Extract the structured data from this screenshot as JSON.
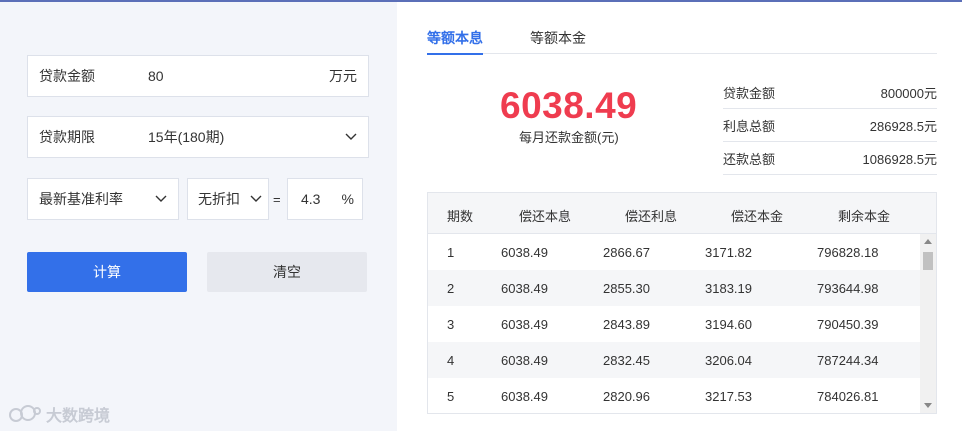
{
  "form": {
    "amount_label": "贷款金额",
    "amount_value": "80",
    "amount_unit": "万元",
    "term_label": "贷款期限",
    "term_value": "15年(180期)",
    "rate_type_label": "最新基准利率",
    "discount_label": "无折扣",
    "equals": "=",
    "rate_value": "4.3",
    "rate_unit": "%",
    "calc_label": "计算",
    "clear_label": "清空"
  },
  "watermark": {
    "text": "大数跨境"
  },
  "tabs": [
    {
      "label": "等额本息",
      "active": true
    },
    {
      "label": "等额本金",
      "active": false
    }
  ],
  "result": {
    "monthly_payment": "6038.49",
    "monthly_caption": "每月还款金额(元)",
    "summary": [
      {
        "label": "贷款金额",
        "value": "800000元"
      },
      {
        "label": "利息总额",
        "value": "286928.5元"
      },
      {
        "label": "还款总额",
        "value": "1086928.5元"
      }
    ]
  },
  "table": {
    "headers": [
      "期数",
      "偿还本息",
      "偿还利息",
      "偿还本金",
      "剩余本金"
    ],
    "rows": [
      [
        "1",
        "6038.49",
        "2866.67",
        "3171.82",
        "796828.18"
      ],
      [
        "2",
        "6038.49",
        "2855.30",
        "3183.19",
        "793644.98"
      ],
      [
        "3",
        "6038.49",
        "2843.89",
        "3194.60",
        "790450.39"
      ],
      [
        "4",
        "6038.49",
        "2832.45",
        "3206.04",
        "787244.34"
      ],
      [
        "5",
        "6038.49",
        "2820.96",
        "3217.53",
        "784026.81"
      ]
    ]
  },
  "colors": {
    "accent": "#3370e9",
    "highlight": "#ef3c4f",
    "panel_bg": "#f3f5fa"
  }
}
